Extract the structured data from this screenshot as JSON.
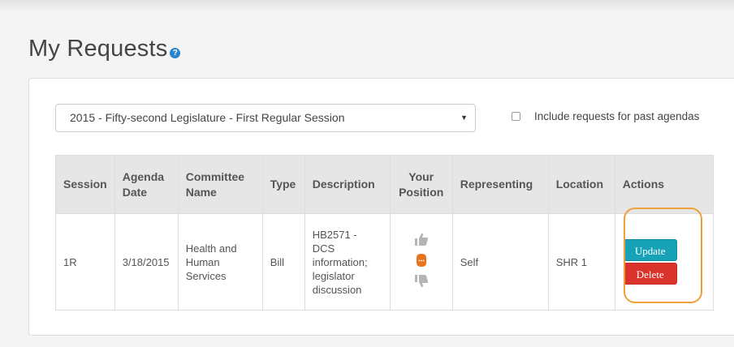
{
  "page": {
    "title": "My Requests",
    "help_icon": "?"
  },
  "filters": {
    "session_select_value": "2015 - Fifty-second Legislature - First Regular Session",
    "past_agendas_label": "Include requests for past agendas",
    "past_agendas_checked": false
  },
  "table": {
    "headers": {
      "session": "Session",
      "agenda_date_1": "Agenda",
      "agenda_date_2": "Date",
      "committee_1": "Committee",
      "committee_2": "Name",
      "type": "Type",
      "description": "Description",
      "position_1": "Your",
      "position_2": "Position",
      "representing": "Representing",
      "location": "Location",
      "actions": "Actions"
    },
    "rows": [
      {
        "session": "1R",
        "agenda_date": "3/18/2015",
        "committee_lines": [
          "Health and",
          "Human",
          "Services"
        ],
        "type": "Bill",
        "description_lines": [
          "HB2571 -",
          "DCS",
          "information;",
          "legislator",
          "discussion"
        ],
        "position": "neutral",
        "position_icons": [
          "thumbs-up-icon",
          "neutral-face-icon",
          "thumbs-down-icon"
        ],
        "representing": "Self",
        "location": "SHR 1",
        "update_label": "Update",
        "delete_label": "Delete"
      }
    ]
  },
  "colors": {
    "update_button": "#17a2b8",
    "delete_button": "#d9332b",
    "highlight_ring": "#f0a03a",
    "neutral_icon": "#e8731a",
    "help_icon": "#2a84c9"
  }
}
